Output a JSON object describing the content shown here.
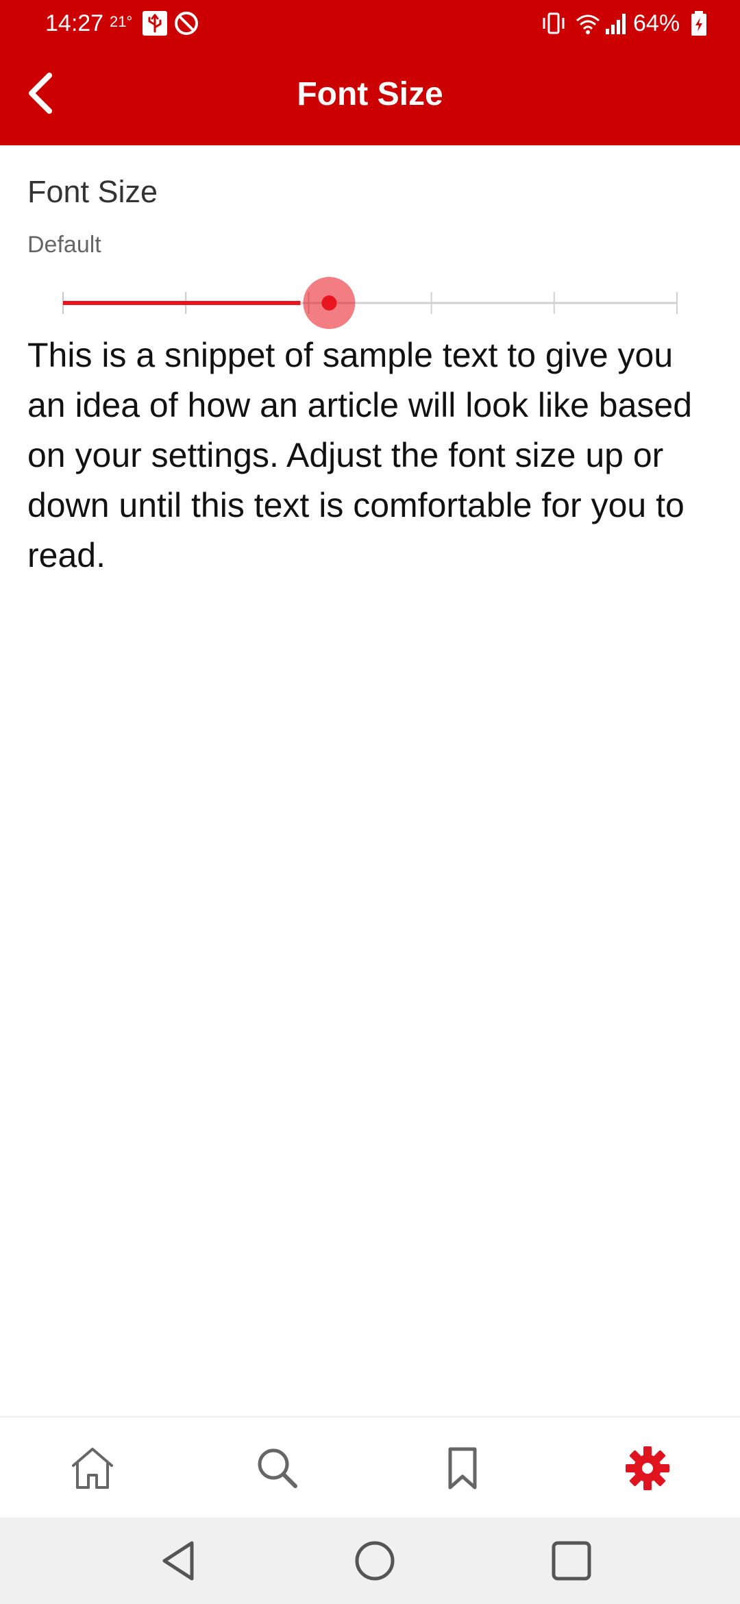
{
  "status_bar": {
    "time": "14:27",
    "temperature": "21°",
    "battery": "64%"
  },
  "app_bar": {
    "title": "Font Size"
  },
  "setting": {
    "title": "Font Size",
    "value": "Default",
    "slider": {
      "steps": 6,
      "selected_index": 2,
      "accent_color": "#e8141e"
    }
  },
  "sample_text": "This is a snippet of sample text to give you an idea of how an article will look like based on your settings. Adjust the font size up or down until this text is comfortable for you to read.",
  "bottom_nav": {
    "items": [
      {
        "icon": "home-icon",
        "active": false
      },
      {
        "icon": "search-icon",
        "active": false
      },
      {
        "icon": "bookmark-icon",
        "active": false
      },
      {
        "icon": "gear-icon",
        "active": true
      }
    ]
  },
  "colors": {
    "brand_red": "#cc0000",
    "active_icon": "#e0141e",
    "inactive_icon": "#666666"
  }
}
